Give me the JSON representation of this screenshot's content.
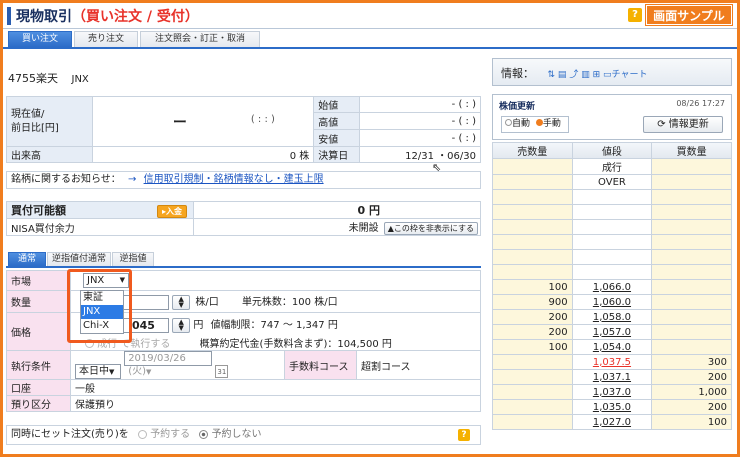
{
  "header": {
    "title_main": "現物取引",
    "title_sub": "（買い注文 / 受付）",
    "help_icon_text": "?",
    "sample_badge": "画面サンプル"
  },
  "tabs": [
    {
      "label": "買い注文",
      "active": true
    },
    {
      "label": "売り注文",
      "active": false
    },
    {
      "label": "注文照会・訂正・取消",
      "active": false
    }
  ],
  "stock": {
    "code_name": "4755楽天",
    "market": "JNX"
  },
  "quote": {
    "current_label": "現在値/",
    "change_label": "前日比[円]",
    "current_value": "ー",
    "current_time": "( : : )",
    "volume_label": "出来高",
    "volume_value": "0 株",
    "open_label": "始値",
    "open_value": "- ( : )",
    "high_label": "高値",
    "high_value": "- ( : )",
    "low_label": "安値",
    "low_value": "- ( : )",
    "settle_label": "決算日",
    "settle_value": "12/31 ・06/30"
  },
  "notice": {
    "label": "銘柄に関するお知らせ：",
    "arrow": "→",
    "link": "信用取引規制・銘柄情報なし・建玉上限"
  },
  "buying_power": {
    "label": "買付可能額",
    "deposit_button": "▸入金",
    "value": "0 円",
    "nisa_label": "NISA買付余力",
    "nisa_value": "未開設",
    "hide_button": "▲この枠を非表示にする"
  },
  "order_tabs": [
    {
      "label": "通常",
      "active": true
    },
    {
      "label": "逆指値付通常",
      "active": false
    },
    {
      "label": "逆指値",
      "active": false
    }
  ],
  "form": {
    "market_label": "市場",
    "market_selected": "JNX",
    "market_options": [
      "東証",
      "JNX",
      "Chi-X"
    ],
    "quantity_label": "数量",
    "quantity_unit": "株/口",
    "unit_shares": "単元株数：100 株/口",
    "price_label": "価格",
    "price_value": "045",
    "price_unit": "円",
    "price_limit": "値幅制限：747 〜 1,347 円",
    "market_order_label": "成行 で執行する",
    "estimated_label": "概算約定代金(手数料含まず)：104,500 円",
    "condition_label": "執行条件",
    "condition_value": "本日中",
    "date_value": "2019/03/26 (火)",
    "fee_label": "手数料コース",
    "fee_value": "超割コース",
    "account_label": "口座",
    "account_value": "一般",
    "deposit_label": "預り区分",
    "deposit_value": "保護預り"
  },
  "set_order": {
    "label": "同時にセット注文(売り)を",
    "option_yes": "予約する",
    "option_no": "予約しない"
  },
  "info_panel": {
    "label": "情報：",
    "chart_button": "チャート"
  },
  "price_update": {
    "title": "株価更新",
    "timestamp": "08/26 17:27",
    "auto_label": "自動",
    "manual_label": "手動",
    "refresh_button": "情報更新"
  },
  "order_book": {
    "headers": [
      "売数量",
      "値段",
      "買数量"
    ],
    "rows": [
      {
        "sell": "",
        "price": "成行",
        "buy": "",
        "link": false
      },
      {
        "sell": "",
        "price": "OVER",
        "buy": "",
        "link": false
      },
      {
        "sell": "",
        "price": "",
        "buy": ""
      },
      {
        "sell": "",
        "price": "",
        "buy": ""
      },
      {
        "sell": "",
        "price": "",
        "buy": ""
      },
      {
        "sell": "",
        "price": "",
        "buy": ""
      },
      {
        "sell": "",
        "price": "",
        "buy": ""
      },
      {
        "sell": "",
        "price": "",
        "buy": ""
      },
      {
        "sell": "100",
        "price": "1,066.0",
        "buy": "",
        "link": true
      },
      {
        "sell": "900",
        "price": "1,060.0",
        "buy": "",
        "link": true
      },
      {
        "sell": "200",
        "price": "1,058.0",
        "buy": "",
        "link": true
      },
      {
        "sell": "200",
        "price": "1,057.0",
        "buy": "",
        "link": true
      },
      {
        "sell": "100",
        "price": "1,054.0",
        "buy": "",
        "link": true
      },
      {
        "sell": "",
        "price": "1,037.5",
        "buy": "300",
        "link": true,
        "red": true
      },
      {
        "sell": "",
        "price": "1,037.1",
        "buy": "200",
        "link": true
      },
      {
        "sell": "",
        "price": "1,037.0",
        "buy": "1,000",
        "link": true
      },
      {
        "sell": "",
        "price": "1,035.0",
        "buy": "200",
        "link": true
      },
      {
        "sell": "",
        "price": "1,027.0",
        "buy": "100",
        "link": true
      }
    ]
  }
}
